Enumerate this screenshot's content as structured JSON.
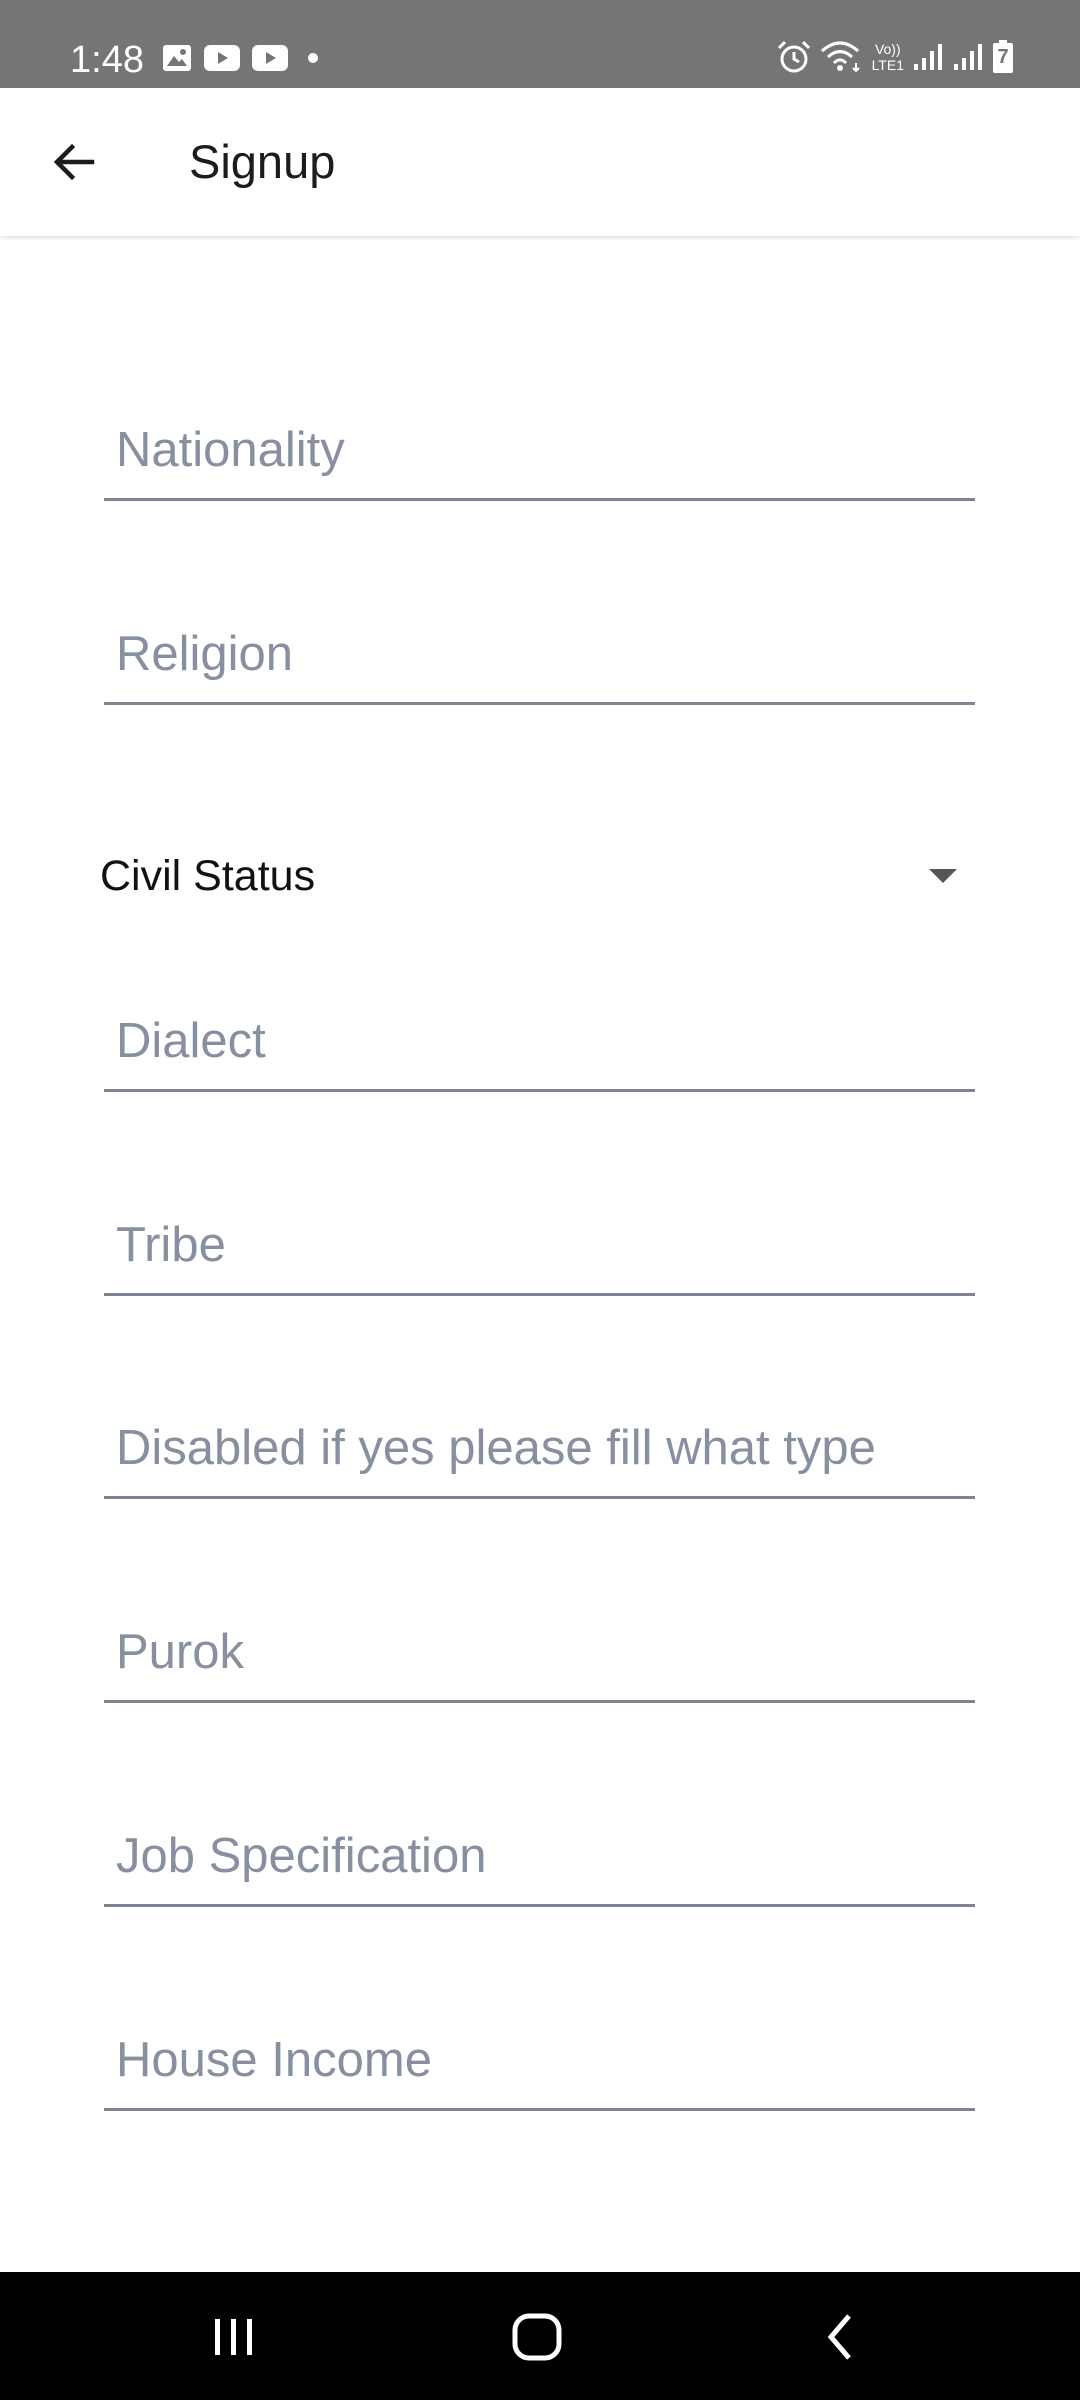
{
  "status_bar": {
    "time": "1:48",
    "left_icons": [
      "image-icon",
      "youtube-icon",
      "youtube-icon",
      "dot-icon"
    ],
    "right_icons": [
      "alarm-icon",
      "wifi-icon",
      "volte-lte1-icon",
      "signal-icon",
      "signal-icon",
      "battery-icon"
    ],
    "volte_label_top": "Vo))",
    "volte_label_bottom": "LTE1",
    "battery_level": "7"
  },
  "app_bar": {
    "title": "Signup",
    "back_icon": "arrow-left-icon"
  },
  "form": {
    "nationality": {
      "placeholder": "Nationality",
      "value": ""
    },
    "religion": {
      "placeholder": "Religion",
      "value": ""
    },
    "civil_status": {
      "label": "Civil Status",
      "icon": "dropdown-arrow-icon"
    },
    "dialect": {
      "placeholder": "Dialect",
      "value": ""
    },
    "tribe": {
      "placeholder": "Tribe",
      "value": ""
    },
    "disabled": {
      "placeholder": "Disabled if yes please fill what type",
      "value": ""
    },
    "purok": {
      "placeholder": "Purok",
      "value": ""
    },
    "job_specification": {
      "placeholder": "Job Specification",
      "value": ""
    },
    "house_income": {
      "placeholder": "House Income",
      "value": ""
    }
  },
  "nav_bar": {
    "recents_icon": "recents-icon",
    "home_icon": "home-icon",
    "back_icon": "chevron-left-icon"
  },
  "colors": {
    "status_bar_bg": "#757575",
    "app_bar_bg": "#ffffff",
    "underline": "#7d8592",
    "placeholder": "#8790a0",
    "nav_bar_bg": "#000000"
  }
}
